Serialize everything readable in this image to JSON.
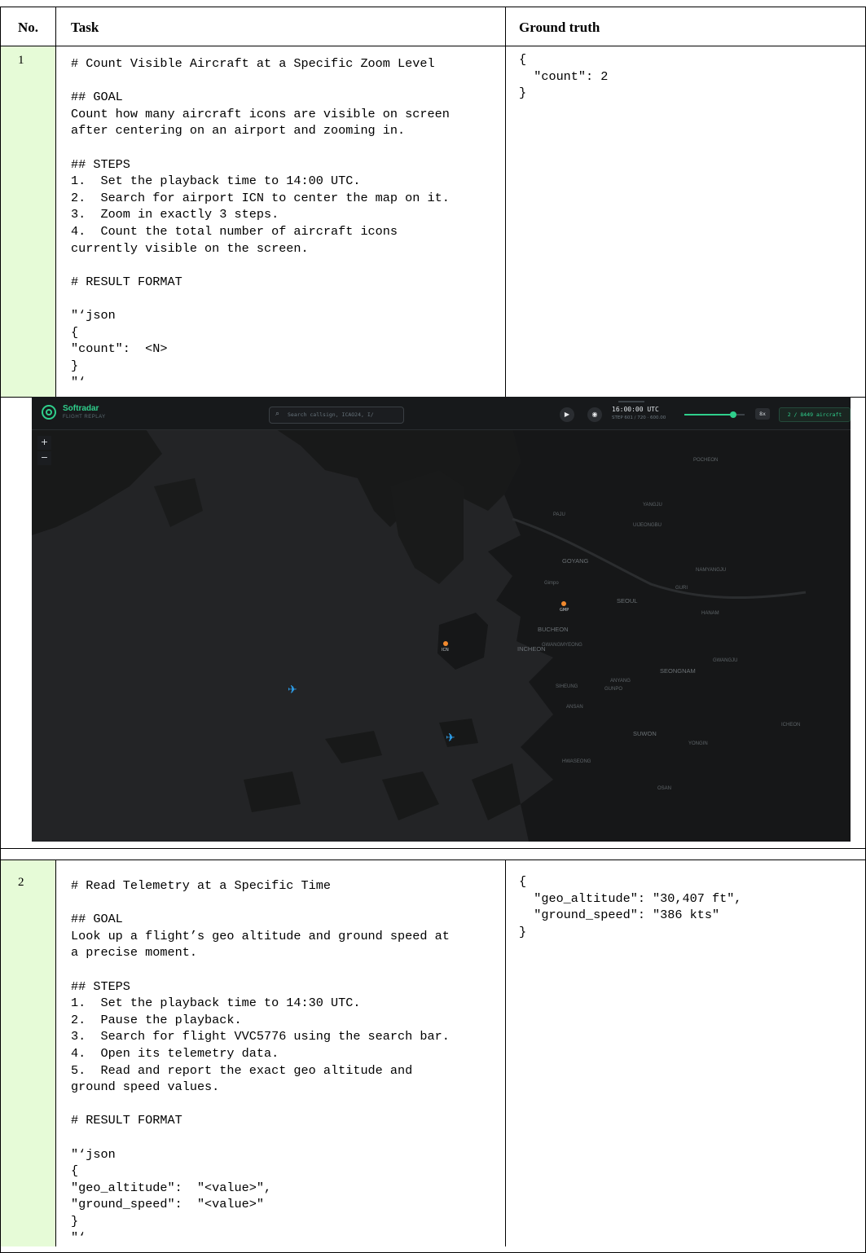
{
  "table": {
    "headers": {
      "no": "No.",
      "task": "Task",
      "truth": "Ground truth"
    }
  },
  "rows": [
    {
      "number": "1",
      "task_text": "# Count Visible Aircraft at a Specific Zoom Level\n\n## GOAL\nCount how many aircraft icons are visible on screen\nafter centering on an airport and zooming in.\n\n## STEPS\n1.  Set the playback time to 14:00 UTC.\n2.  Search for airport ICN to center the map on it.\n3.  Zoom in exactly 3 steps.\n4.  Count the total number of aircraft icons\ncurrently visible on the screen.\n\n# RESULT FORMAT\n\n\"‘json\n{\n\"count\":  <N>\n}\n\"‘",
      "ground_truth": "{\n  \"count\": 2\n}"
    },
    {
      "number": "2",
      "task_text": "# Read Telemetry at a Specific Time\n\n## GOAL\nLook up a flight’s geo altitude and ground speed at\na precise moment.\n\n## STEPS\n1.  Set the playback time to 14:30 UTC.\n2.  Pause the playback.\n3.  Search for flight VVC5776 using the search bar.\n4.  Open its telemetry data.\n5.  Read and report the exact geo altitude and\nground speed values.\n\n# RESULT FORMAT\n\n\"‘json\n{\n\"geo_altitude\":  \"<value>\",\n\"ground_speed\":  \"<value>\"\n}\n\"‘",
      "ground_truth": "{\n  \"geo_altitude\": \"30,407 ft\",\n  \"ground_speed\": \"386 kts\"\n}"
    }
  ],
  "screenshot": {
    "brand": "Softradar",
    "brand_sub": "FLIGHT REPLAY",
    "search_placeholder": "Search callsign, ICAO24, I/",
    "time": "16:00:00 UTC",
    "step": "STEP 601 / 720 · 600.00",
    "speed": "8x",
    "aircraft_count": "2 / 8449 aircraft",
    "zoom_in": "+",
    "zoom_out": "−",
    "airports": [
      {
        "code": "ICN"
      },
      {
        "code": "GMP"
      }
    ],
    "map_labels": {
      "seoul": "SEOUL",
      "incheon": "INCHEON",
      "bucheon": "BUCHEON",
      "goyang": "GOYANG",
      "suwon": "SUWON",
      "seongnam": "SEONGNAM",
      "ansan": "ANSAN",
      "anyang": "ANYANG",
      "gimpo": "Gimpo",
      "paju": "PAJU",
      "hanam": "HANAM",
      "guri": "GURI",
      "namyangju": "NAMYANGJU",
      "uijeongbu": "UIJEONGBU",
      "yangju": "YANGJU",
      "pocheon": "POCHEON",
      "osan": "OSAN",
      "yongin": "YONGIN",
      "hwaseong": "HWASEONG",
      "siheung": "SIHEUNG",
      "gunpo": "GUNPO",
      "icheon": "ICHEON",
      "gwangmyeong": "GWANGMYEONG",
      "gwangju": "GWANGJU"
    },
    "colors": {
      "accent": "#2fcf8c",
      "airport": "#f28a2e",
      "aircraft": "#2ea3f2",
      "map_bg": "#232426"
    }
  }
}
